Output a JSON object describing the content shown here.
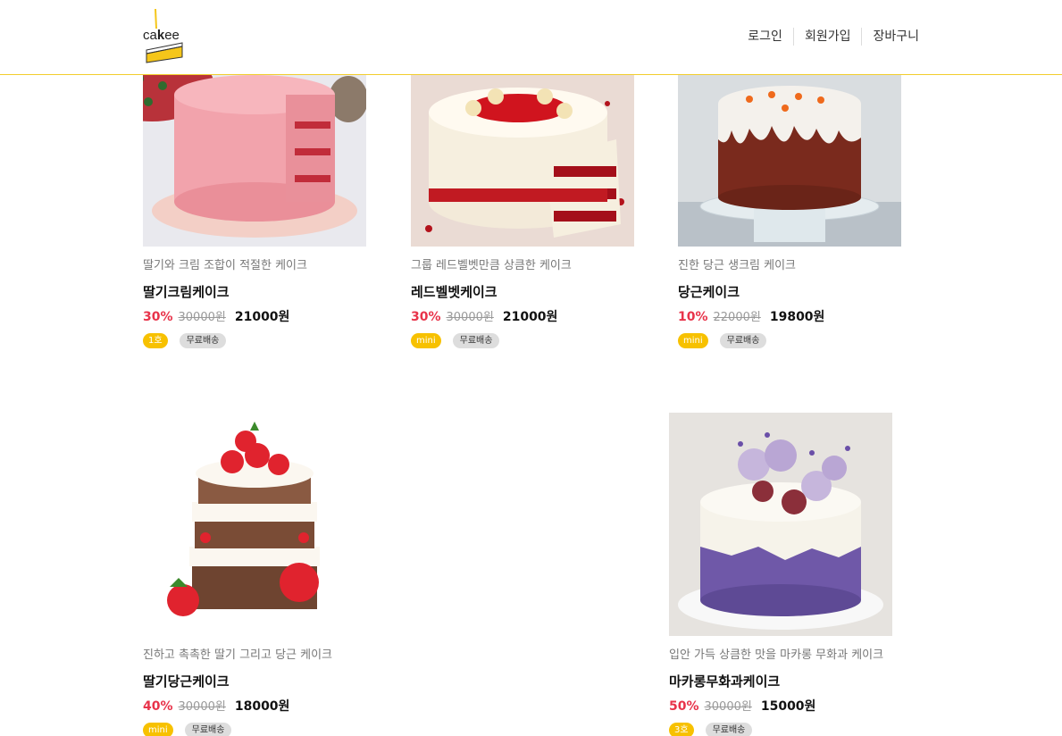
{
  "header": {
    "logo_text": "cakee",
    "nav": [
      "로그인",
      "회원가입",
      "장바구니"
    ]
  },
  "products": [
    {
      "image": "pink-strawberry-cake",
      "desc": "딸기와 크림 조합이 적절한 케이크",
      "name": "딸기크림케이크",
      "rate": "30%",
      "original": "30000원",
      "sale": "21000원",
      "size": "1호",
      "ship": "무료배송"
    },
    {
      "image": "red-velvet-cake",
      "desc": "그룹 레드벨벳만큼 상큼한 케이크",
      "name": "레드벨벳케이크",
      "rate": "30%",
      "original": "30000원",
      "sale": "21000원",
      "size": "mini",
      "ship": "무료배송"
    },
    {
      "image": "carrot-cake",
      "desc": "진한 당근 생크림 케이크",
      "name": "당근케이크",
      "rate": "10%",
      "original": "22000원",
      "sale": "19800원",
      "size": "mini",
      "ship": "무료배송"
    },
    {
      "image": "strawberry-carrot-cake",
      "desc": "진하고 촉촉한 딸기 그리고 당근 케이크",
      "name": "딸기당근케이크",
      "rate": "40%",
      "original": "30000원",
      "sale": "18000원",
      "size": "mini",
      "ship": "무료배송"
    },
    {
      "image": "macaron-fig-cake",
      "desc": "입안 가득 상큼한 맛을 마카롱 무화과 케이크",
      "name": "마카롱무화과케이크",
      "rate": "50%",
      "original": "30000원",
      "sale": "15000원",
      "size": "3호",
      "ship": "무료배송"
    }
  ],
  "colors": {
    "accent": "#f2cd2c",
    "discount": "#e8334a",
    "size_tag": "#f7c100"
  }
}
